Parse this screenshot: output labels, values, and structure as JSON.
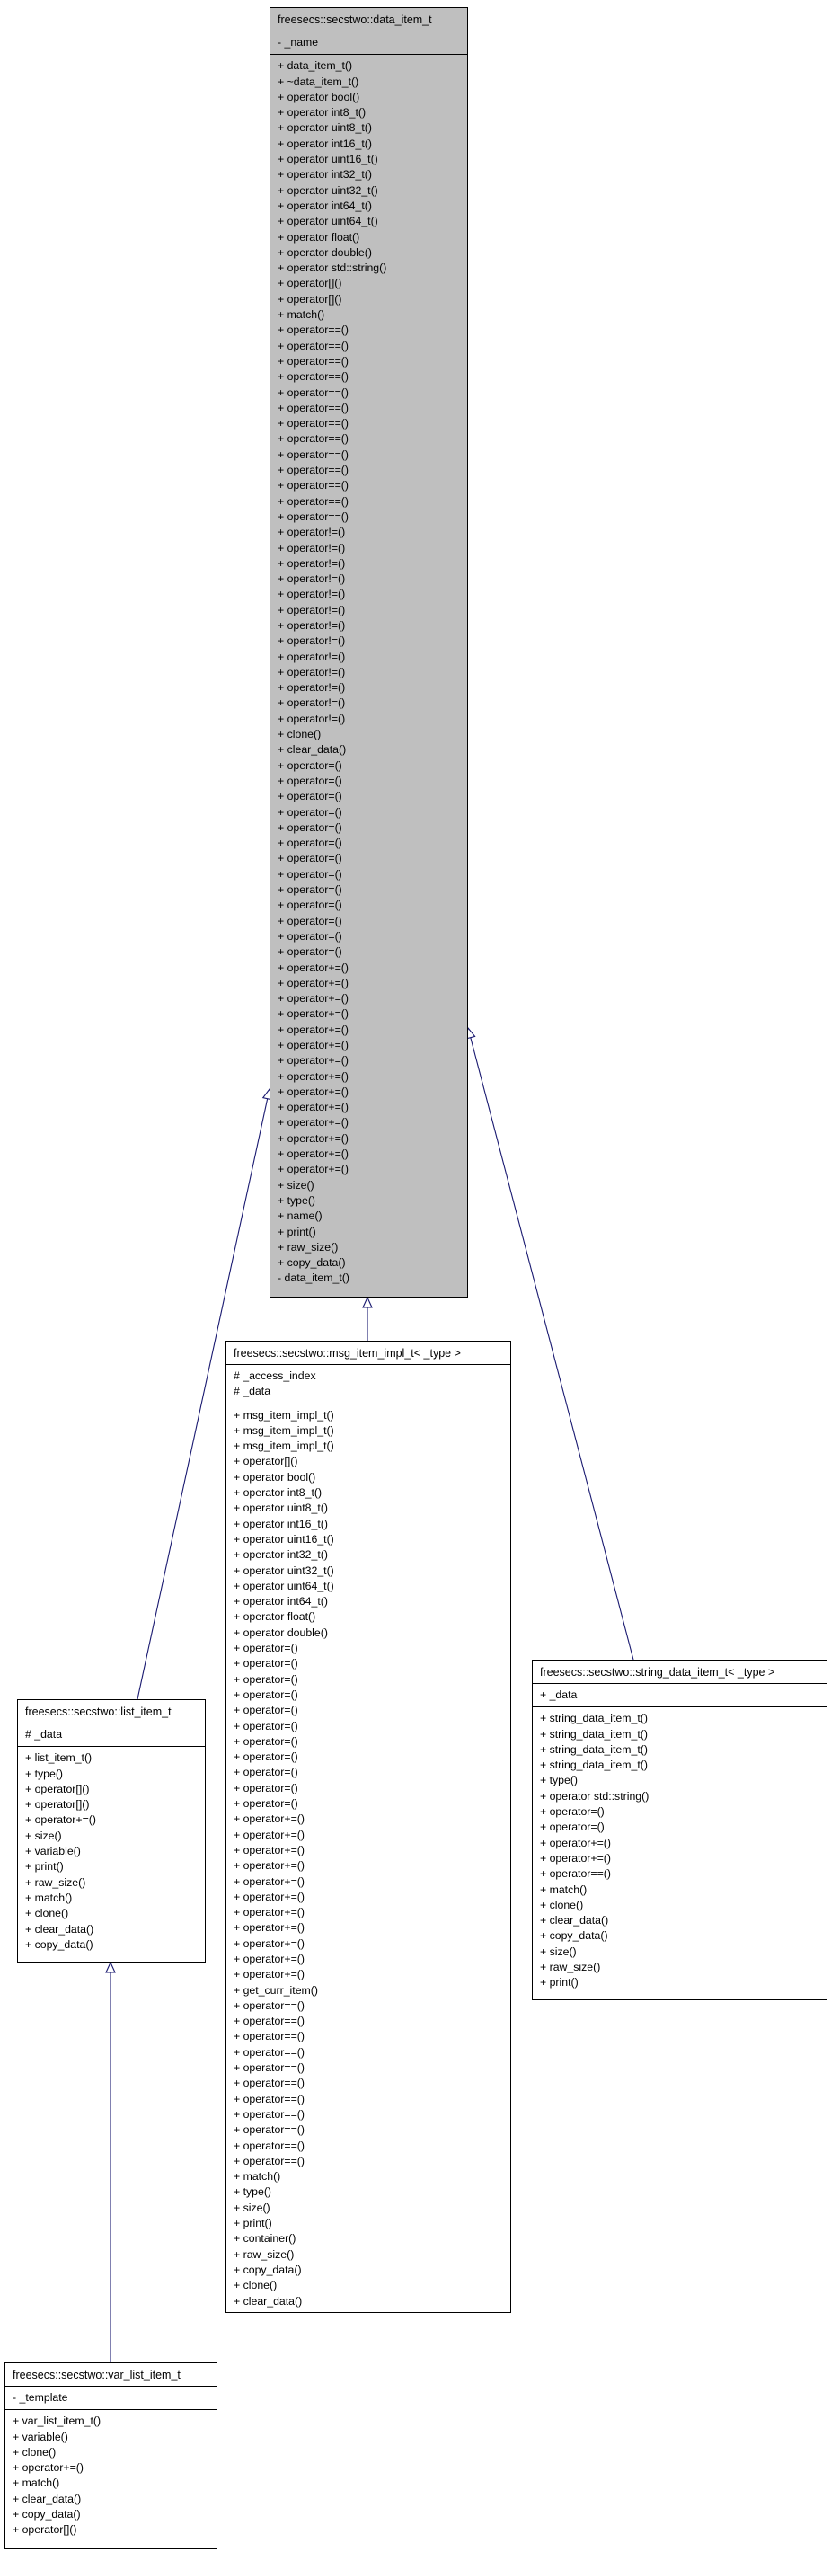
{
  "edge_color": "#191970",
  "base_fill": "#bfbfbf",
  "classes": {
    "data_item": {
      "title": "freesecs::secstwo::data_item_t",
      "attributes": [
        "- _name"
      ],
      "operations": [
        "+ data_item_t()",
        "+ ~data_item_t()",
        "+ operator bool()",
        "+ operator int8_t()",
        "+ operator uint8_t()",
        "+ operator int16_t()",
        "+ operator uint16_t()",
        "+ operator int32_t()",
        "+ operator uint32_t()",
        "+ operator int64_t()",
        "+ operator uint64_t()",
        "+ operator float()",
        "+ operator double()",
        "+ operator std::string()",
        "+ operator[]()",
        "+ operator[]()",
        "+ match()",
        "+ operator==()",
        "+ operator==()",
        "+ operator==()",
        "+ operator==()",
        "+ operator==()",
        "+ operator==()",
        "+ operator==()",
        "+ operator==()",
        "+ operator==()",
        "+ operator==()",
        "+ operator==()",
        "+ operator==()",
        "+ operator==()",
        "+ operator!=()",
        "+ operator!=()",
        "+ operator!=()",
        "+ operator!=()",
        "+ operator!=()",
        "+ operator!=()",
        "+ operator!=()",
        "+ operator!=()",
        "+ operator!=()",
        "+ operator!=()",
        "+ operator!=()",
        "+ operator!=()",
        "+ operator!=()",
        "+ clone()",
        "+ clear_data()",
        "+ operator=()",
        "+ operator=()",
        "+ operator=()",
        "+ operator=()",
        "+ operator=()",
        "+ operator=()",
        "+ operator=()",
        "+ operator=()",
        "+ operator=()",
        "+ operator=()",
        "+ operator=()",
        "+ operator=()",
        "+ operator=()",
        "+ operator+=()",
        "+ operator+=()",
        "+ operator+=()",
        "+ operator+=()",
        "+ operator+=()",
        "+ operator+=()",
        "+ operator+=()",
        "+ operator+=()",
        "+ operator+=()",
        "+ operator+=()",
        "+ operator+=()",
        "+ operator+=()",
        "+ operator+=()",
        "+ operator+=()",
        "+ size()",
        "+ type()",
        "+ name()",
        "+ print()",
        "+ raw_size()",
        "+ copy_data()",
        "- data_item_t()"
      ]
    },
    "msg_item_impl": {
      "title": "freesecs::secstwo::msg_item_impl_t< _type >",
      "attributes": [
        "# _access_index",
        "# _data"
      ],
      "operations": [
        "+ msg_item_impl_t()",
        "+ msg_item_impl_t()",
        "+ msg_item_impl_t()",
        "+ operator[]()",
        "+ operator bool()",
        "+ operator int8_t()",
        "+ operator uint8_t()",
        "+ operator int16_t()",
        "+ operator uint16_t()",
        "+ operator int32_t()",
        "+ operator uint32_t()",
        "+ operator uint64_t()",
        "+ operator int64_t()",
        "+ operator float()",
        "+ operator double()",
        "+ operator=()",
        "+ operator=()",
        "+ operator=()",
        "+ operator=()",
        "+ operator=()",
        "+ operator=()",
        "+ operator=()",
        "+ operator=()",
        "+ operator=()",
        "+ operator=()",
        "+ operator=()",
        "+ operator+=()",
        "+ operator+=()",
        "+ operator+=()",
        "+ operator+=()",
        "+ operator+=()",
        "+ operator+=()",
        "+ operator+=()",
        "+ operator+=()",
        "+ operator+=()",
        "+ operator+=()",
        "+ operator+=()",
        "+ get_curr_item()",
        "+ operator==()",
        "+ operator==()",
        "+ operator==()",
        "+ operator==()",
        "+ operator==()",
        "+ operator==()",
        "+ operator==()",
        "+ operator==()",
        "+ operator==()",
        "+ operator==()",
        "+ operator==()",
        "+ match()",
        "+ type()",
        "+ size()",
        "+ print()",
        "+ container()",
        "+ raw_size()",
        "+ copy_data()",
        "+ clone()",
        "+ clear_data()"
      ]
    },
    "list_item": {
      "title": "freesecs::secstwo::list_item_t",
      "attributes": [
        "# _data"
      ],
      "operations": [
        "+ list_item_t()",
        "+ type()",
        "+ operator[]()",
        "+ operator[]()",
        "+ operator+=()",
        "+ size()",
        "+ variable()",
        "+ print()",
        "+ raw_size()",
        "+ match()",
        "+ clone()",
        "+ clear_data()",
        "+ copy_data()"
      ]
    },
    "string_data_item": {
      "title": "freesecs::secstwo::string_data_item_t< _type >",
      "attributes": [
        "+ _data"
      ],
      "operations": [
        "+ string_data_item_t()",
        "+ string_data_item_t()",
        "+ string_data_item_t()",
        "+ string_data_item_t()",
        "+ type()",
        "+ operator std::string()",
        "+ operator=()",
        "+ operator=()",
        "+ operator+=()",
        "+ operator+=()",
        "+ operator==()",
        "+ match()",
        "+ clone()",
        "+ clear_data()",
        "+ copy_data()",
        "+ size()",
        "+ raw_size()",
        "+ print()"
      ]
    },
    "var_list_item": {
      "title": "freesecs::secstwo::var_list_item_t",
      "attributes": [
        "- _template"
      ],
      "operations": [
        "+ var_list_item_t()",
        "+ variable()",
        "+ clone()",
        "+ operator+=()",
        "+ match()",
        "+ clear_data()",
        "+ copy_data()",
        "+ operator[]()"
      ]
    }
  },
  "inheritance": [
    {
      "child": "msg_item_impl",
      "parent": "data_item"
    },
    {
      "child": "list_item",
      "parent": "data_item"
    },
    {
      "child": "string_data_item",
      "parent": "data_item"
    },
    {
      "child": "var_list_item",
      "parent": "list_item"
    }
  ]
}
